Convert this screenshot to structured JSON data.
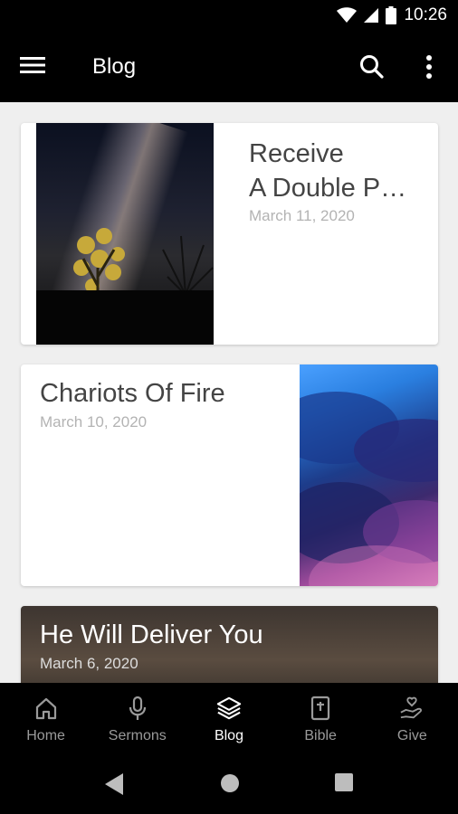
{
  "status_bar": {
    "time": "10:26"
  },
  "app_bar": {
    "title": "Blog"
  },
  "posts": [
    {
      "title_line1": "Receive",
      "title_line2": "A Double P…",
      "date": "March 11, 2020"
    },
    {
      "title": "Chariots Of Fire",
      "date": "March 10, 2020"
    },
    {
      "title": "He Will Deliver You",
      "date": "March 6, 2020"
    }
  ],
  "bottom_nav": [
    {
      "label": "Home",
      "icon": "home-icon"
    },
    {
      "label": "Sermons",
      "icon": "microphone-icon"
    },
    {
      "label": "Blog",
      "icon": "layers-icon",
      "active": true
    },
    {
      "label": "Bible",
      "icon": "bible-icon"
    },
    {
      "label": "Give",
      "icon": "give-icon"
    }
  ],
  "colors": {
    "bar": "#000000",
    "background": "#efefef",
    "active": "#ffffff",
    "inactive": "#9a9a9a"
  }
}
